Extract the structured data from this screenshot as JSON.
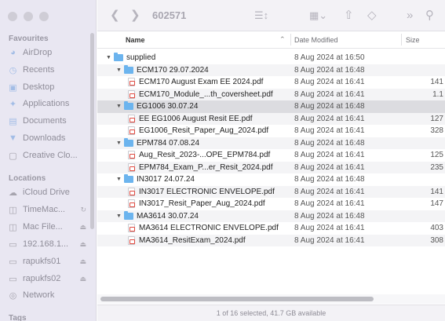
{
  "toolbar": {
    "title": "602571",
    "back_icon": "chevron-left",
    "forward_icon": "chevron-right",
    "view_icon": "list-view",
    "group_icon": "grid-view",
    "share_icon": "share",
    "tag_icon": "tag",
    "more_icon": "double-chevron",
    "search_icon": "search"
  },
  "sidebar": {
    "favourites_label": "Favourites",
    "favourites": [
      {
        "label": "AirDrop",
        "icon": "airdrop-icon"
      },
      {
        "label": "Recents",
        "icon": "clock-icon"
      },
      {
        "label": "Desktop",
        "icon": "desktop-icon"
      },
      {
        "label": "Applications",
        "icon": "applications-icon"
      },
      {
        "label": "Documents",
        "icon": "document-icon"
      },
      {
        "label": "Downloads",
        "icon": "download-icon"
      },
      {
        "label": "Creative Clo...",
        "icon": "file-icon"
      }
    ],
    "locations_label": "Locations",
    "locations": [
      {
        "label": "iCloud Drive",
        "icon": "cloud-icon"
      },
      {
        "label": "TimeMac...",
        "icon": "disk-icon"
      },
      {
        "label": "Mac File...",
        "icon": "disk-icon"
      },
      {
        "label": "192.168.1...",
        "icon": "monitor-icon"
      },
      {
        "label": "rapukfs01",
        "icon": "monitor-icon"
      },
      {
        "label": "rapukfs02",
        "icon": "monitor-icon"
      },
      {
        "label": "Network",
        "icon": "globe-icon"
      }
    ],
    "tags_label": "Tags"
  },
  "columns": {
    "name": "Name",
    "date": "Date Modified",
    "size": "Size"
  },
  "rows": [
    {
      "level": 0,
      "type": "folder",
      "name": "supplied",
      "date": "8 Aug 2024 at 16:50",
      "size": ""
    },
    {
      "level": 1,
      "type": "folder",
      "name": "ECM170 29.07.2024",
      "date": "8 Aug 2024 at 16:48",
      "size": ""
    },
    {
      "level": 2,
      "type": "pdf",
      "name": "ECM170 August Exam EE 2024.pdf",
      "date": "8 Aug 2024 at 16:41",
      "size": "141"
    },
    {
      "level": 2,
      "type": "pdf",
      "name": "ECM170_Module_...th_coversheet.pdf",
      "date": "8 Aug 2024 at 16:41",
      "size": "1.1"
    },
    {
      "level": 1,
      "type": "folder",
      "name": "EG1006 30.07.24",
      "date": "8 Aug 2024 at 16:48",
      "size": "",
      "selected": true
    },
    {
      "level": 2,
      "type": "pdf",
      "name": "EE EG1006 August Resit EE.pdf",
      "date": "8 Aug 2024 at 16:41",
      "size": "127"
    },
    {
      "level": 2,
      "type": "pdf",
      "name": "EG1006_Resit_Paper_Aug_2024.pdf",
      "date": "8 Aug 2024 at 16:41",
      "size": "328"
    },
    {
      "level": 1,
      "type": "folder",
      "name": "EPM784 07.08.24",
      "date": "8 Aug 2024 at 16:48",
      "size": ""
    },
    {
      "level": 2,
      "type": "pdf",
      "name": "Aug_Resit_2023-...OPE_EPM784.pdf",
      "date": "8 Aug 2024 at 16:41",
      "size": "125"
    },
    {
      "level": 2,
      "type": "pdf",
      "name": "EPM784_Exam_P...er_Resit_2024.pdf",
      "date": "8 Aug 2024 at 16:41",
      "size": "235"
    },
    {
      "level": 1,
      "type": "folder",
      "name": "IN3017 24.07.24",
      "date": "8 Aug 2024 at 16:48",
      "size": ""
    },
    {
      "level": 2,
      "type": "pdf",
      "name": "IN3017 ELECTRONIC ENVELOPE.pdf",
      "date": "8 Aug 2024 at 16:41",
      "size": "141"
    },
    {
      "level": 2,
      "type": "pdf",
      "name": "IN3017_Resit_Paper_Aug_2024.pdf",
      "date": "8 Aug 2024 at 16:41",
      "size": "147"
    },
    {
      "level": 1,
      "type": "folder",
      "name": "MA3614 30.07.24",
      "date": "8 Aug 2024 at 16:48",
      "size": ""
    },
    {
      "level": 2,
      "type": "pdf",
      "name": "MA3614 ELECTRONIC ENVELOPE.pdf",
      "date": "8 Aug 2024 at 16:41",
      "size": "403"
    },
    {
      "level": 2,
      "type": "pdf",
      "name": "MA3614_ResitExam_2024.pdf",
      "date": "8 Aug 2024 at 16:41",
      "size": "308"
    }
  ],
  "status": {
    "text": "1 of 16 selected, 41.7 GB available"
  }
}
